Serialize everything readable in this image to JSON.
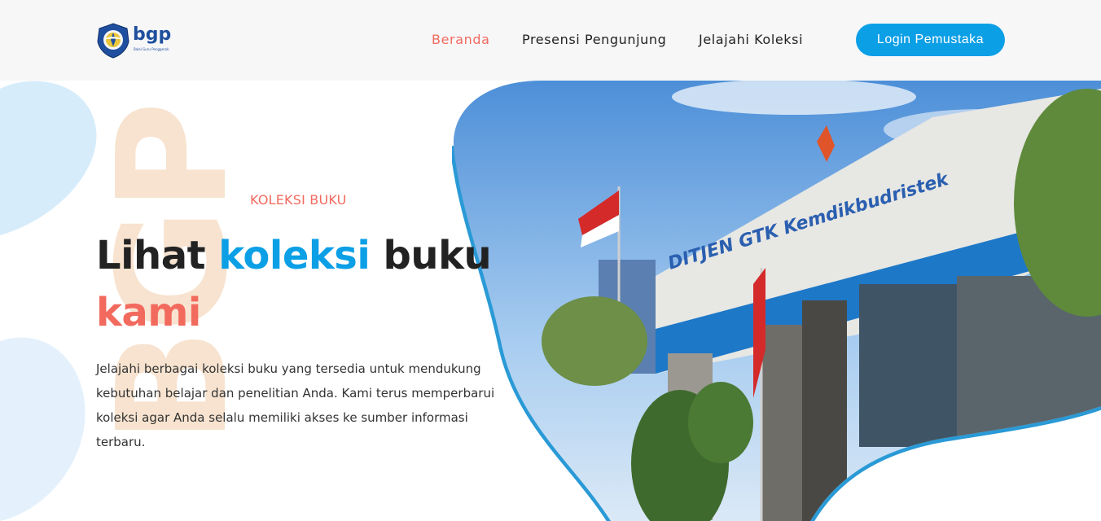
{
  "brand": {
    "logo_text": "bgp",
    "logo_subtext": "Balai Guru Penggerak"
  },
  "nav": {
    "items": [
      {
        "label": "Beranda",
        "active": true
      },
      {
        "label": "Presensi Pengunjung",
        "active": false
      },
      {
        "label": "Jelajahi Koleksi",
        "active": false
      }
    ],
    "login_label": "Login Pemustaka"
  },
  "hero": {
    "eyebrow": "KOLEKSI BUKU",
    "headline_part1": "Lihat ",
    "headline_highlight": "koleksi",
    "headline_part2": " buku",
    "headline_line2": "kami",
    "description": "Jelajahi berbagai koleksi buku yang tersedia untuk mendukung kebutuhan belajar dan penelitian Anda. Kami terus memperbarui koleksi agar Anda selalu memiliki akses ke sumber informasi terbaru.",
    "watermark": "BGP"
  },
  "photo": {
    "sign_text": "DITJEN GTK Kemdikbudristek"
  },
  "colors": {
    "accent_blue": "#0b9fe6",
    "accent_red": "#f26a5e",
    "header_bg": "#f7f7f8",
    "watermark": "#f7e3cf"
  }
}
